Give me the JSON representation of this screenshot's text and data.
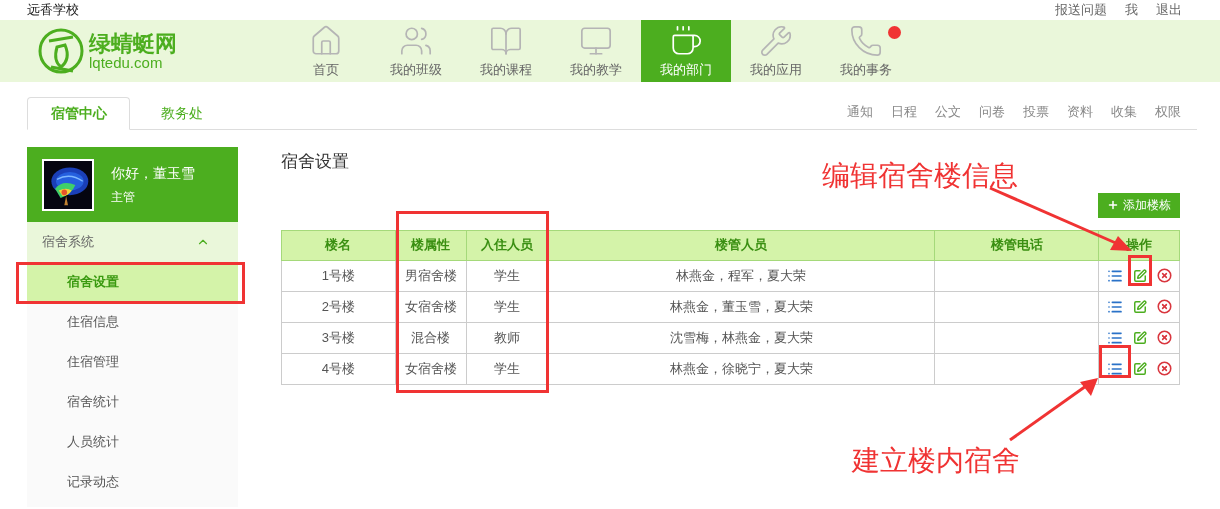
{
  "top_bar": {
    "school": "远香学校",
    "links": [
      "报送问题",
      "我",
      "退出"
    ]
  },
  "logo": {
    "name": "绿蜻蜓网",
    "domain": "lqtedu.com"
  },
  "nav": [
    {
      "label": "首页",
      "selected": false,
      "notification": false
    },
    {
      "label": "我的班级",
      "selected": false,
      "notification": false
    },
    {
      "label": "我的课程",
      "selected": false,
      "notification": false
    },
    {
      "label": "我的教学",
      "selected": false,
      "notification": false
    },
    {
      "label": "我的部门",
      "selected": true,
      "notification": false
    },
    {
      "label": "我的应用",
      "selected": false,
      "notification": false
    },
    {
      "label": "我的事务",
      "selected": false,
      "notification": true
    }
  ],
  "tabs": [
    {
      "label": "宿管中心",
      "selected": true
    },
    {
      "label": "教务处",
      "selected": false
    }
  ],
  "module_links": [
    "通知",
    "日程",
    "公文",
    "问卷",
    "投票",
    "资料",
    "收集",
    "权限"
  ],
  "profile": {
    "greeting": "你好，董玉雪",
    "role": "主管"
  },
  "sidebar": {
    "group": {
      "label": "宿舍系统",
      "expanded": true
    },
    "items": [
      {
        "label": "宿舍设置",
        "selected": true
      },
      {
        "label": "住宿信息",
        "selected": false
      },
      {
        "label": "住宿管理",
        "selected": false
      },
      {
        "label": "宿舍统计",
        "selected": false
      },
      {
        "label": "人员统计",
        "selected": false
      },
      {
        "label": "记录动态",
        "selected": false
      }
    ]
  },
  "page_title": "宿舍设置",
  "add_button": "添加楼栋",
  "table": {
    "columns": [
      "楼名",
      "楼属性",
      "入住人员",
      "楼管人员",
      "楼管电话",
      "操作"
    ],
    "rows": [
      [
        "1号楼",
        "男宿舍楼",
        "学生",
        "林燕金，程军，夏大荣"
      ],
      [
        "2号楼",
        "女宿舍楼",
        "学生",
        "林燕金，董玉雪，夏大荣"
      ],
      [
        "3号楼",
        "混合楼",
        "教师",
        "沈雪梅，林燕金，夏大荣"
      ],
      [
        "4号楼",
        "女宿舍楼",
        "学生",
        "林燕金，徐晓宁，夏大荣"
      ]
    ]
  },
  "annotations": [
    {
      "text": "编辑宿舍楼信息"
    },
    {
      "text": "建立楼内宿舍"
    }
  ]
}
